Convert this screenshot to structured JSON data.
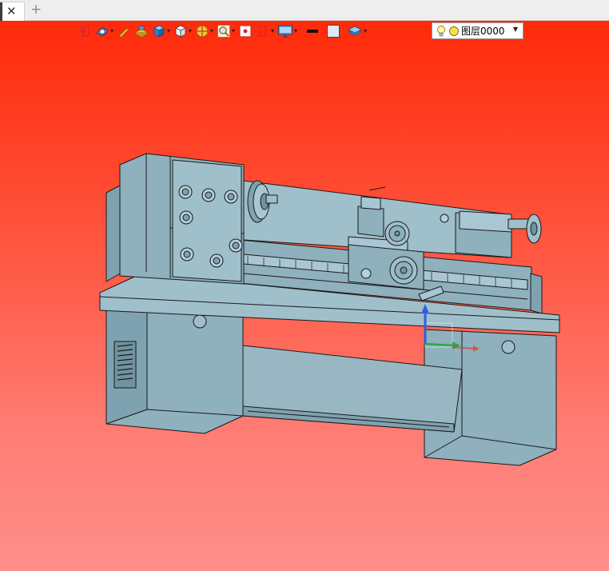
{
  "tabs": {
    "close_glyph": "✕",
    "add_glyph": "+"
  },
  "toolbar": {
    "tools": [
      "exit-sketch-icon",
      "view-display-icon",
      "pencil-icon",
      "part-color-icon",
      "shaded-cube-icon",
      "wireframe-cube-icon",
      "section-view-icon",
      "zoom-area-icon",
      "fit-view-icon",
      "ruler-icon",
      "monitor-settings-icon",
      "line-color-icon",
      "fill-color-icon",
      "layers-icon"
    ],
    "layer_value": "图层0000"
  },
  "colors": {
    "viewport_top": "#ff2a0a",
    "viewport_bottom": "#ff8f8a",
    "model_face": "#8fb0bd",
    "model_face_light": "#a9c7d2",
    "model_face_dark": "#6f93a1",
    "edge": "#1a1a1a",
    "triad_z": "#2f5fe0",
    "triad_y": "#2ca84a",
    "triad_x": "#d6402c"
  }
}
